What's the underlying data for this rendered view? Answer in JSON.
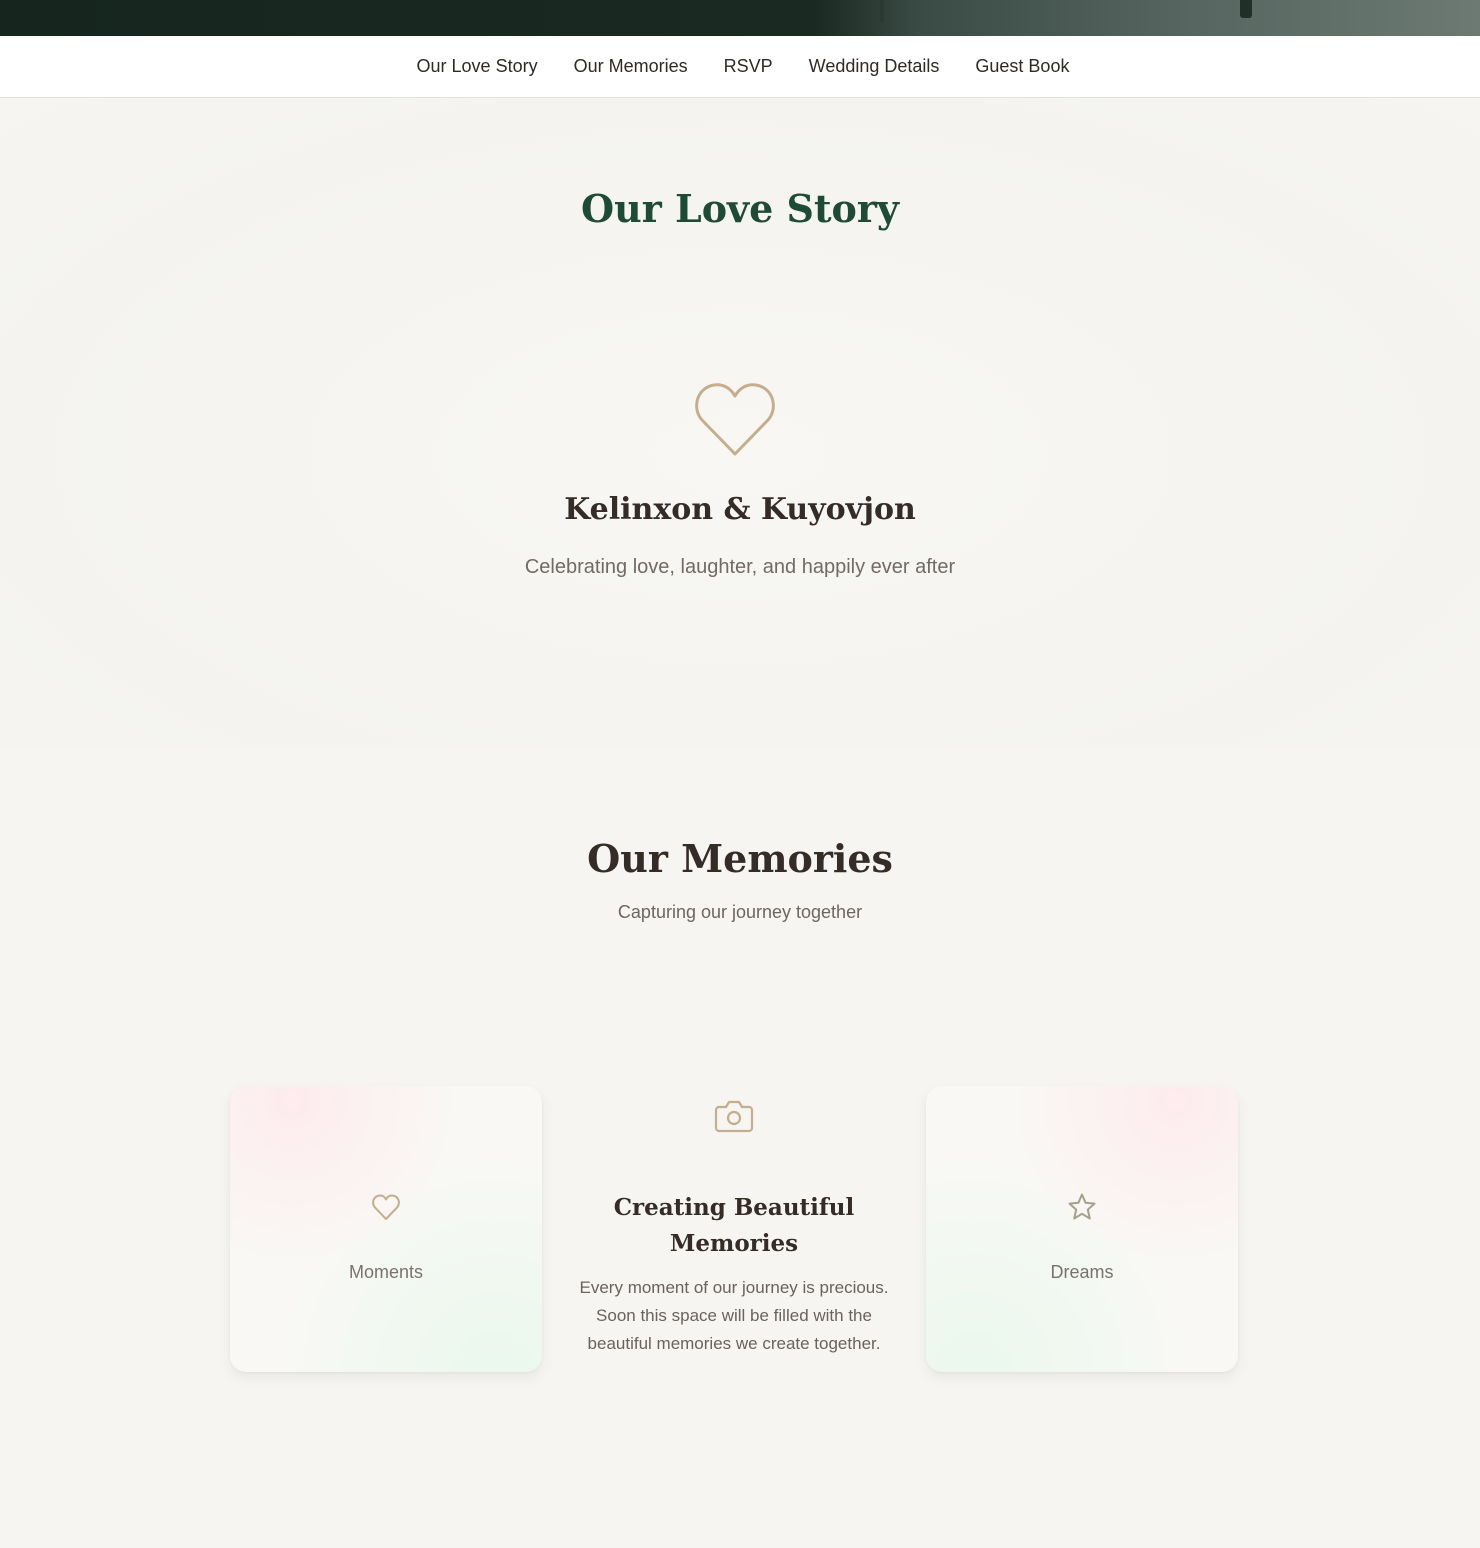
{
  "nav": {
    "items": [
      {
        "label": "Our Love Story"
      },
      {
        "label": "Our Memories"
      },
      {
        "label": "RSVP"
      },
      {
        "label": "Wedding Details"
      },
      {
        "label": "Guest Book"
      }
    ]
  },
  "love_story": {
    "title": "Our Love Story",
    "icon": "heart-outline-icon",
    "names": "Kelinxon & Kuyovjon",
    "tagline": "Celebrating love, laughter, and happily ever after"
  },
  "memories": {
    "title": "Our Memories",
    "subtitle": "Capturing our journey together",
    "cards": [
      {
        "icon": "heart-icon",
        "label": "Moments"
      },
      {
        "icon": "star-icon",
        "label": "Dreams"
      }
    ],
    "feature": {
      "icon": "camera-icon",
      "title": "Creating Beautiful Memories",
      "text": "Every moment of our journey is precious. Soon this space will be filled with the beautiful memories we create together."
    }
  },
  "colors": {
    "accent_green": "#1f4a36",
    "gold": "#c4ae8e",
    "background": "#f6f5f1"
  }
}
